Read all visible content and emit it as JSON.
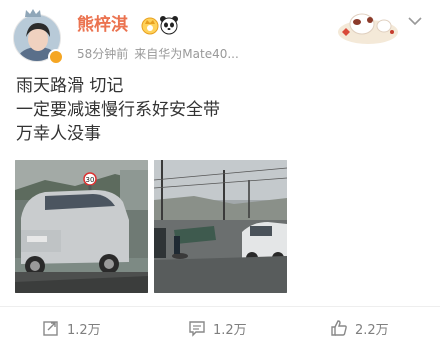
{
  "post": {
    "author": "熊梓淇",
    "time": "58分钟前",
    "source": "来自华为Mate40...",
    "lines": [
      "雨天路滑  切记",
      "一定要减速慢行系好安全带",
      "万幸人没事"
    ],
    "images": [
      {
        "label": "30",
        "description_icon": "car-photo"
      },
      {
        "description_icon": "road-photo"
      }
    ]
  },
  "actions": {
    "repost": "1.2万",
    "comment": "1.2万",
    "like": "2.2万"
  },
  "icons": {
    "vip": "crown-vip-icon",
    "panda": "panda-icon",
    "repost": "repost-icon",
    "comment": "comment-icon",
    "like": "thumbs-up-icon",
    "chevron": "chevron-down-icon"
  },
  "colors": {
    "username": "#eb7350",
    "meta": "#999999",
    "actions": "#7f7f7f"
  }
}
